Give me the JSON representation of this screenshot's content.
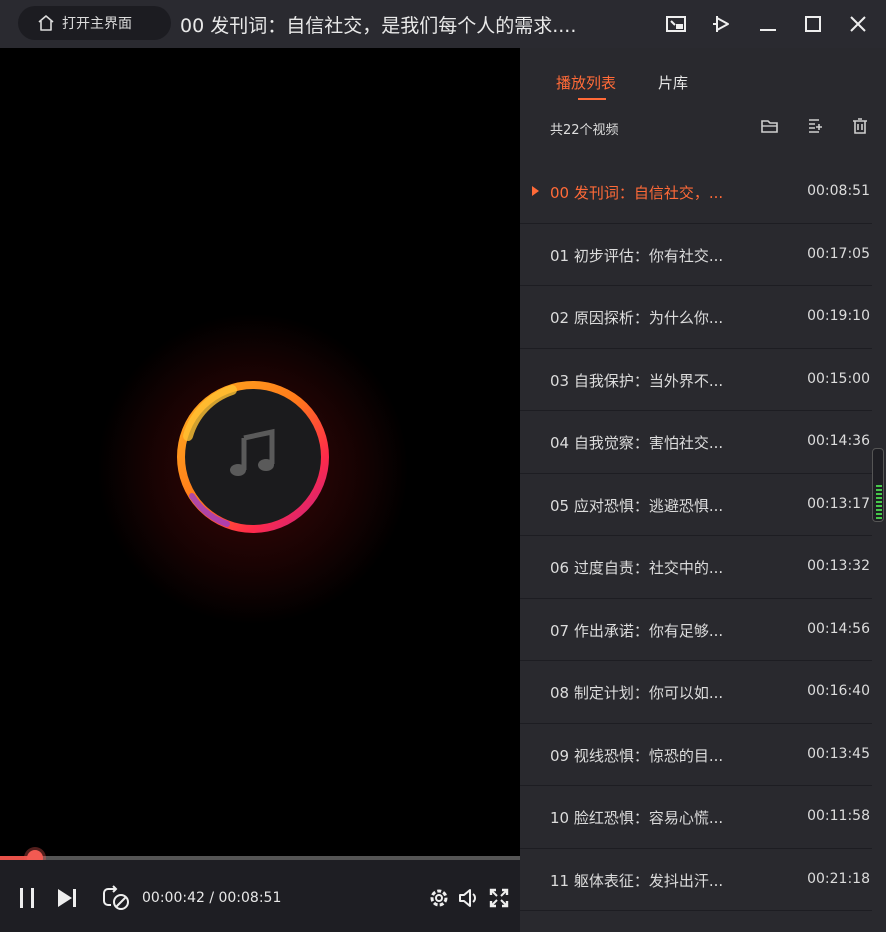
{
  "titlebar": {
    "home_label": "打开主界面",
    "title": "00 发刊词：自信社交，是我们每个人的需求...."
  },
  "player": {
    "time_display": "00:00:42 / 00:08:51",
    "progress": 0.079
  },
  "panel": {
    "tabs": [
      "播放列表",
      "片库"
    ],
    "count_label": "共22个视频",
    "items": [
      {
        "name": "00 发刊词：自信社交，...",
        "duration": "00:08:51"
      },
      {
        "name": "01 初步评估：你有社交...",
        "duration": "00:17:05"
      },
      {
        "name": "02 原因探析：为什么你...",
        "duration": "00:19:10"
      },
      {
        "name": "03 自我保护：当外界不...",
        "duration": "00:15:00"
      },
      {
        "name": "04 自我觉察：害怕社交...",
        "duration": "00:14:36"
      },
      {
        "name": "05 应对恐惧：逃避恐惧...",
        "duration": "00:13:17"
      },
      {
        "name": "06 过度自责：社交中的...",
        "duration": "00:13:32"
      },
      {
        "name": "07 作出承诺：你有足够...",
        "duration": "00:14:56"
      },
      {
        "name": "08 制定计划：你可以如...",
        "duration": "00:16:40"
      },
      {
        "name": "09 视线恐惧：惊恐的目...",
        "duration": "00:13:45"
      },
      {
        "name": "10 脸红恐惧：容易心慌...",
        "duration": "00:11:58"
      },
      {
        "name": "11 躯体表征：发抖出汗...",
        "duration": "00:21:18"
      }
    ]
  },
  "colors": {
    "accent": "#ff6a38",
    "panel_bg": "#29292e",
    "titlebar_bg": "#2a2a30"
  }
}
